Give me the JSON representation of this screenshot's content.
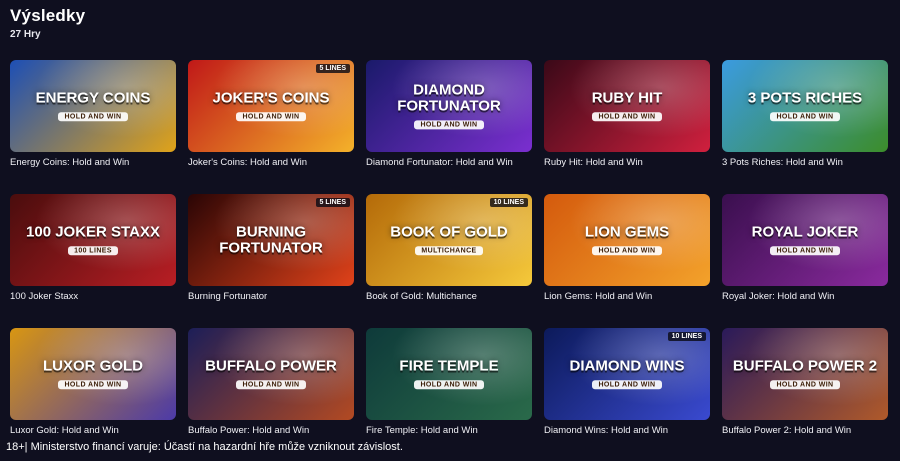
{
  "page": {
    "title": "Výsledky",
    "count": "27 Hry"
  },
  "games": [
    {
      "name": "Energy Coins: Hold and Win",
      "logo": "Energy Coins",
      "tag": "Hold and Win",
      "lines": "",
      "colors": [
        "#1d4fb5",
        "#e0a319"
      ]
    },
    {
      "name": "Joker's Coins: Hold and Win",
      "logo": "Joker's Coins",
      "tag": "Hold and Win",
      "lines": "5 LINES",
      "colors": [
        "#c01818",
        "#f4b22a"
      ]
    },
    {
      "name": "Diamond Fortunator: Hold and Win",
      "logo": "Diamond Fortunator",
      "tag": "Hold and Win",
      "lines": "",
      "colors": [
        "#1a1a6a",
        "#7b2fd0"
      ]
    },
    {
      "name": "Ruby Hit: Hold and Win",
      "logo": "Ruby Hit",
      "tag": "Hold and Win",
      "lines": "",
      "colors": [
        "#3a0918",
        "#d0203e"
      ]
    },
    {
      "name": "3 Pots Riches: Hold and Win",
      "logo": "3 Pots Riches",
      "tag": "Hold and Win",
      "lines": "",
      "colors": [
        "#3b9be0",
        "#3c8d2a"
      ]
    },
    {
      "name": "100 Joker Staxx",
      "logo": "100 Joker Staxx",
      "tag": "100 Lines",
      "lines": "",
      "colors": [
        "#4a0d0d",
        "#b81e24"
      ]
    },
    {
      "name": "Burning Fortunator",
      "logo": "Burning Fortunator",
      "tag": "",
      "lines": "5 LINES",
      "colors": [
        "#2a0505",
        "#e0421a"
      ]
    },
    {
      "name": "Book of Gold: Multichance",
      "logo": "Book of Gold",
      "tag": "Multichance",
      "lines": "10 LINES",
      "colors": [
        "#b46a09",
        "#f5c93b"
      ]
    },
    {
      "name": "Lion Gems: Hold and Win",
      "logo": "Lion Gems",
      "tag": "Hold and Win",
      "lines": "",
      "colors": [
        "#d45a0d",
        "#f3a22b"
      ]
    },
    {
      "name": "Royal Joker: Hold and Win",
      "logo": "Royal Joker",
      "tag": "Hold and Win",
      "lines": "",
      "colors": [
        "#3a0f4e",
        "#8a2a9e"
      ]
    },
    {
      "name": "Luxor Gold: Hold and Win",
      "logo": "Luxor Gold",
      "tag": "Hold and Win",
      "lines": "",
      "colors": [
        "#d89612",
        "#4c3aa8"
      ]
    },
    {
      "name": "Buffalo Power: Hold and Win",
      "logo": "Buffalo Power",
      "tag": "Hold and Win",
      "lines": "",
      "colors": [
        "#1c1e58",
        "#b34a22"
      ]
    },
    {
      "name": "Fire Temple: Hold and Win",
      "logo": "Fire Temple",
      "tag": "Hold and Win",
      "lines": "",
      "colors": [
        "#0e3a3a",
        "#2a6a4a"
      ]
    },
    {
      "name": "Diamond Wins: Hold and Win",
      "logo": "Diamond Wins",
      "tag": "Hold and Win",
      "lines": "10 LINES",
      "colors": [
        "#0c1a5a",
        "#3a4ad0"
      ]
    },
    {
      "name": "Buffalo Power 2: Hold and Win",
      "logo": "Buffalo Power 2",
      "tag": "Hold and Win",
      "lines": "",
      "colors": [
        "#2a1a5a",
        "#b05a2a"
      ]
    }
  ],
  "footer": {
    "disclaimer": "18+| Ministerstvo financí varuje: Účastí na hazardní hře může vzniknout závislost."
  }
}
